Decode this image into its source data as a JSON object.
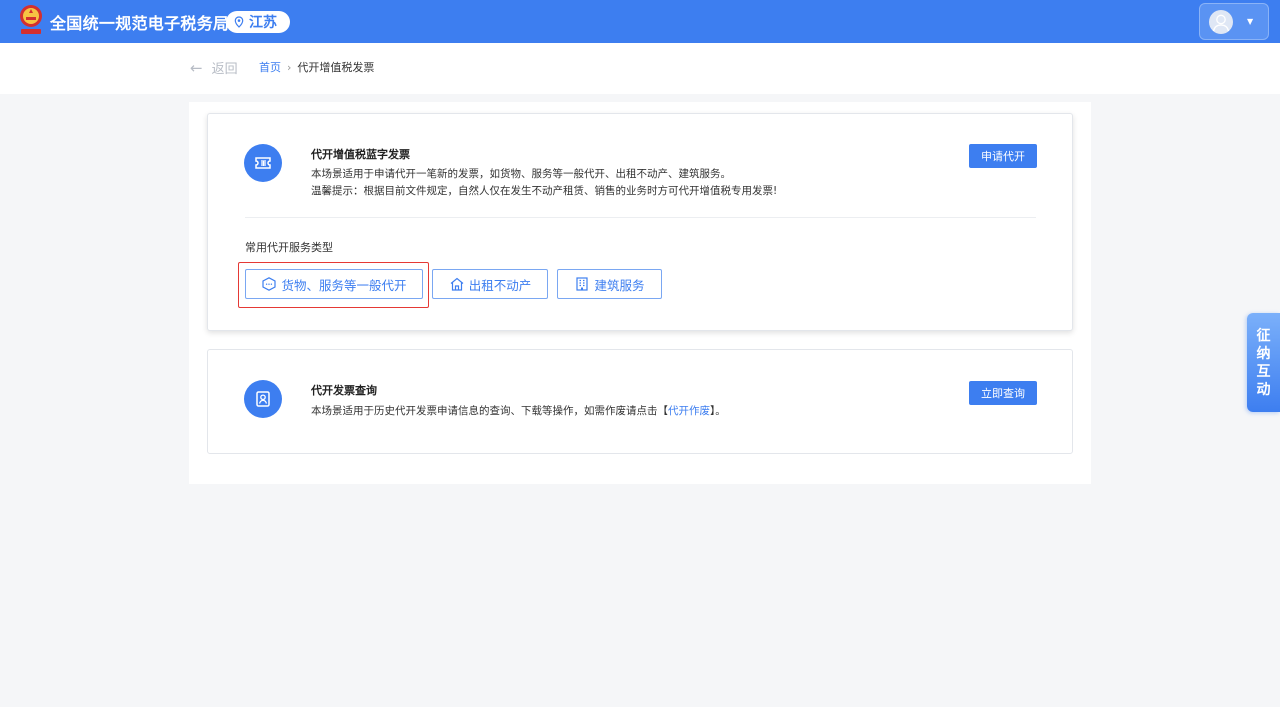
{
  "header": {
    "site_title": "全国统一规范电子税务局",
    "region": "江苏",
    "user_caret": "▼"
  },
  "subbar": {
    "back_label": "返回",
    "back_arrow": "←",
    "breadcrumb_home": "首页",
    "breadcrumb_sep": "›",
    "breadcrumb_current": "代开增值税发票"
  },
  "blue_invoice": {
    "title": "代开增值税蓝字发票",
    "desc_line1": "本场景适用于申请代开一笔新的发票，如货物、服务等一般代开、出租不动产、建筑服务。",
    "desc_line2": "温馨提示：根据目前文件规定，自然人仅在发生不动产租赁、销售的业务时方可代开增值税专用发票!",
    "apply_button": "申请代开",
    "section_label": "常用代开服务类型",
    "services": [
      {
        "label": "货物、服务等一般代开",
        "icon": "cube-icon"
      },
      {
        "label": "出租不动产",
        "icon": "house-icon"
      },
      {
        "label": "建筑服务",
        "icon": "building-icon"
      }
    ]
  },
  "query": {
    "title": "代开发票查询",
    "desc_prefix": "本场景适用于历史代开发票申请信息的查询、下载等操作，如需作废请点击【",
    "desc_link": "代开作废",
    "desc_suffix": "】。",
    "query_button": "立即查询"
  },
  "float_tab": {
    "chars": [
      "征",
      "纳",
      "互",
      "动"
    ]
  },
  "colors": {
    "primary": "#3d7ef0",
    "highlight": "#e53935"
  }
}
